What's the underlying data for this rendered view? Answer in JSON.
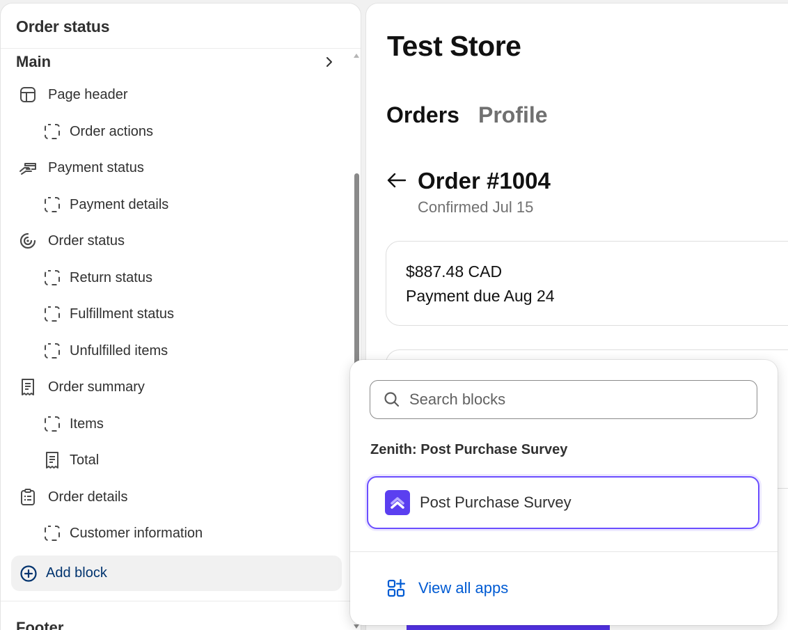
{
  "sidebar": {
    "title": "Order status",
    "main_section": "Main",
    "items": [
      {
        "label": "Page header",
        "icon": "layout-icon"
      },
      {
        "label": "Order actions",
        "icon": "block-placeholder-icon"
      },
      {
        "label": "Payment status",
        "icon": "hand-card-icon"
      },
      {
        "label": "Payment details",
        "icon": "block-placeholder-icon"
      },
      {
        "label": "Order status",
        "icon": "progress-icon"
      },
      {
        "label": "Return status",
        "icon": "block-placeholder-icon"
      },
      {
        "label": "Fulfillment status",
        "icon": "block-placeholder-icon"
      },
      {
        "label": "Unfulfilled items",
        "icon": "block-placeholder-icon"
      },
      {
        "label": "Order summary",
        "icon": "receipt-icon"
      },
      {
        "label": "Items",
        "icon": "block-placeholder-icon"
      },
      {
        "label": "Total",
        "icon": "receipt-icon"
      },
      {
        "label": "Order details",
        "icon": "clipboard-icon"
      },
      {
        "label": "Customer information",
        "icon": "block-placeholder-icon"
      }
    ],
    "add_block": "Add block",
    "footer_section": "Footer"
  },
  "preview": {
    "store_name": "Test Store",
    "nav": {
      "orders": "Orders",
      "profile": "Profile"
    },
    "order_title": "Order #1004",
    "order_subtitle": "Confirmed Jul 15",
    "payment": {
      "amount": "$887.48 CAD",
      "due": "Payment due Aug 24"
    }
  },
  "popover": {
    "search_placeholder": "Search blocks",
    "group_heading": "Zenith: Post Purchase Survey",
    "option_label": "Post Purchase Survey",
    "view_all": "View all apps"
  },
  "colors": {
    "accent": "#6b4eff",
    "link": "#005bd3",
    "add_block_text": "#00336e",
    "app_icon_bg": "#5b3ff0",
    "checkout_button": "#5433eb"
  }
}
